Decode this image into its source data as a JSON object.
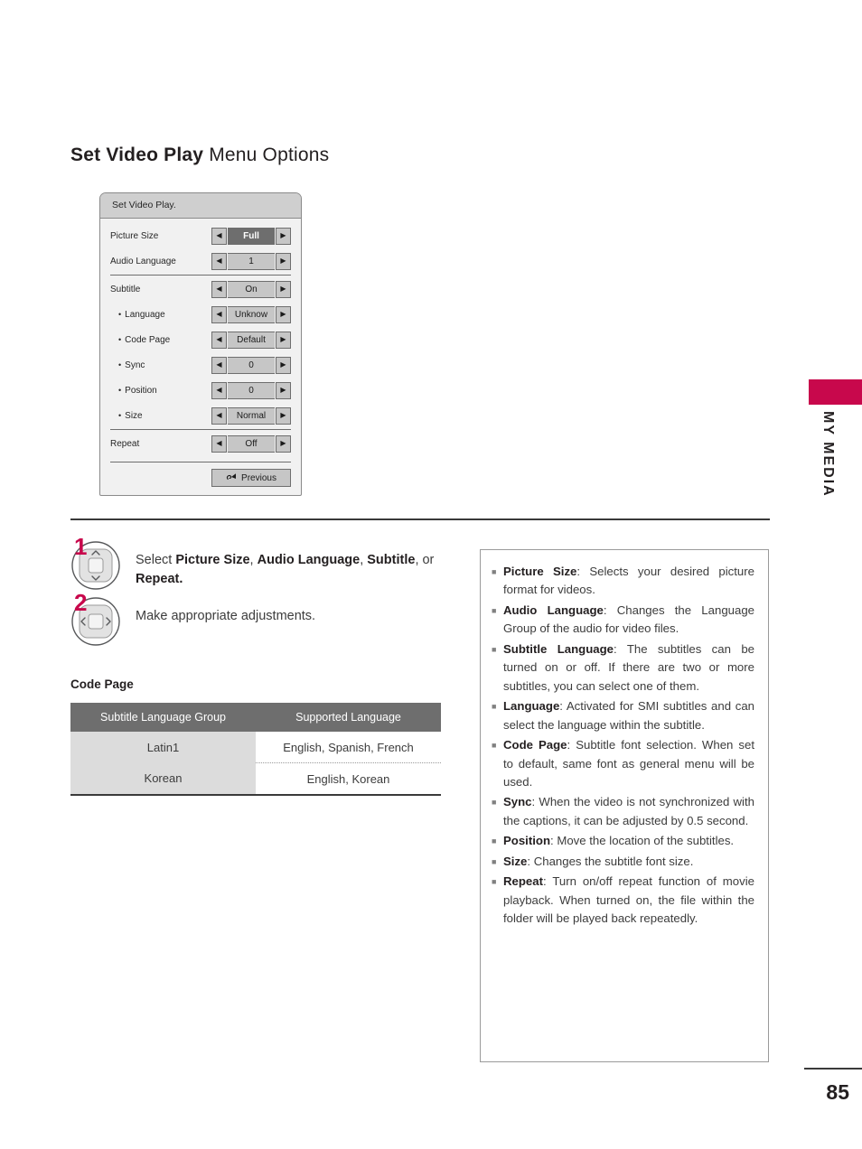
{
  "page": {
    "title_strong": "Set Video Play",
    "title_light": " Menu Options",
    "number": "85",
    "side_tab_label": "MY MEDIA",
    "accent_color": "#c8084c"
  },
  "osd": {
    "titlebar": "Set Video Play.",
    "rows": [
      {
        "label": "Picture Size",
        "value": "Full",
        "sub": false,
        "selected": true,
        "left_arrow": "◀",
        "right_arrow": "▶"
      },
      {
        "label": "Audio Language",
        "value": "1",
        "sub": false,
        "selected": false,
        "left_arrow": "◀",
        "right_arrow": "▶"
      },
      {
        "label": "Subtitle",
        "value": "On",
        "sub": false,
        "selected": false,
        "left_arrow": "◀",
        "right_arrow": "▶"
      },
      {
        "label": "Language",
        "value": "Unknow",
        "sub": true,
        "selected": false,
        "left_arrow": "◀",
        "right_arrow": "▶"
      },
      {
        "label": "Code Page",
        "value": "Default",
        "sub": true,
        "selected": false,
        "left_arrow": "◀",
        "right_arrow": "▶"
      },
      {
        "label": "Sync",
        "value": "0",
        "sub": true,
        "selected": false,
        "left_arrow": "◀",
        "right_arrow": "▶"
      },
      {
        "label": "Position",
        "value": "0",
        "sub": true,
        "selected": false,
        "left_arrow": "◀",
        "right_arrow": "▶"
      },
      {
        "label": "Size",
        "value": "Normal",
        "sub": true,
        "selected": false,
        "left_arrow": "◀",
        "right_arrow": "▶"
      },
      {
        "label": "Repeat",
        "value": "Off",
        "sub": false,
        "selected": false,
        "left_arrow": "◀",
        "right_arrow": "▶"
      }
    ],
    "previous_button": {
      "label": "Previous",
      "icon": "return-arrow-icon"
    }
  },
  "steps": [
    {
      "number": "1",
      "icon": "dpad-up-down-icon",
      "text_parts": [
        {
          "text": "Select ",
          "bold": false
        },
        {
          "text": "Picture Size",
          "bold": true
        },
        {
          "text": ", ",
          "bold": false
        },
        {
          "text": "Audio Language",
          "bold": true
        },
        {
          "text": ", ",
          "bold": false
        },
        {
          "text": "Subtitle",
          "bold": true
        },
        {
          "text": ", or ",
          "bold": false
        },
        {
          "text": "Repeat.",
          "bold": true
        }
      ]
    },
    {
      "number": "2",
      "icon": "dpad-left-right-icon",
      "text_parts": [
        {
          "text": "Make appropriate adjustments.",
          "bold": false
        }
      ]
    }
  ],
  "code_page": {
    "heading": "Code Page",
    "columns": [
      "Subtitle Language Group",
      "Supported Language"
    ],
    "rows": [
      {
        "group": "Latin1",
        "supported": "English, Spanish, French"
      },
      {
        "group": "Korean",
        "supported": "English, Korean"
      }
    ]
  },
  "descriptions": {
    "bullet_glyph": "■",
    "items": [
      {
        "term": "Picture Size",
        "body": ": Selects your desired picture format for videos."
      },
      {
        "term": "Audio Language",
        "body": ": Changes the Language Group of the audio for video files."
      },
      {
        "term": "Subtitle Language",
        "body": ": The subtitles can be turned on or off. If there are two or more subtitles, you can select one of them."
      },
      {
        "term": "Language",
        "body": ": Activated for SMI subtitles and can select the language within the subtitle."
      },
      {
        "term": "Code Page",
        "body": ": Subtitle font selection. When set to default, same font as general menu will be used."
      },
      {
        "term": "Sync",
        "body": ": When the video is not synchronized with the captions, it can be adjusted by 0.5 second."
      },
      {
        "term": "Position",
        "body": ": Move the location of the subtitles."
      },
      {
        "term": "Size",
        "body": ": Changes the subtitle font size."
      },
      {
        "term": "Repeat",
        "body": ": Turn on/off repeat function of movie playback. When turned on, the file within the folder will be played back repeatedly."
      }
    ]
  }
}
